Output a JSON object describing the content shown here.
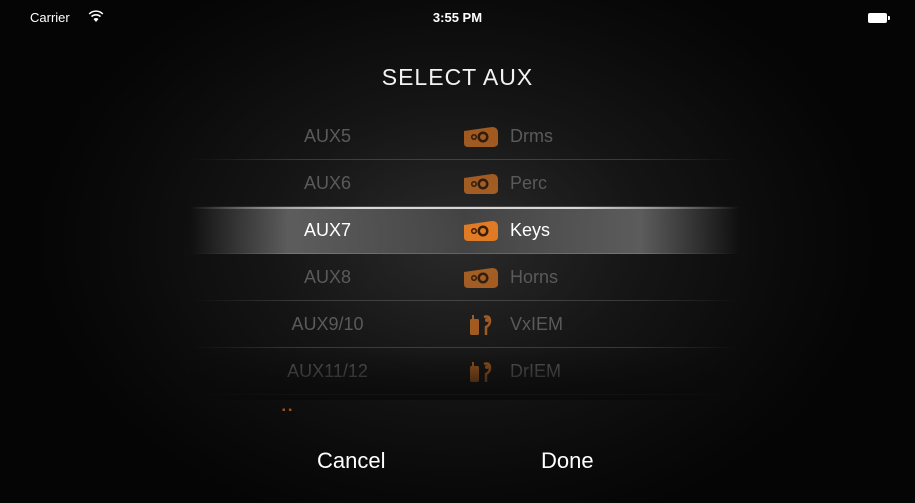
{
  "status_bar": {
    "carrier": "Carrier",
    "time": "3:55 PM",
    "icons": [
      "wifi-icon",
      "battery-icon"
    ]
  },
  "title": "SELECT AUX",
  "picker": {
    "selected_index": 2,
    "accent_color": "#e07a25",
    "items": [
      {
        "aux": "AUX5",
        "icon": "speaker-wedge-icon",
        "name": "Drms"
      },
      {
        "aux": "AUX6",
        "icon": "speaker-wedge-icon",
        "name": "Perc"
      },
      {
        "aux": "AUX7",
        "icon": "speaker-wedge-icon",
        "name": "Keys"
      },
      {
        "aux": "AUX8",
        "icon": "speaker-wedge-icon",
        "name": "Horns"
      },
      {
        "aux": "AUX9/10",
        "icon": "in-ear-monitor-icon",
        "name": "VxIEM"
      },
      {
        "aux": "AUX11/12",
        "icon": "in-ear-monitor-icon",
        "name": "DrIEM"
      }
    ]
  },
  "buttons": {
    "cancel": "Cancel",
    "done": "Done"
  }
}
